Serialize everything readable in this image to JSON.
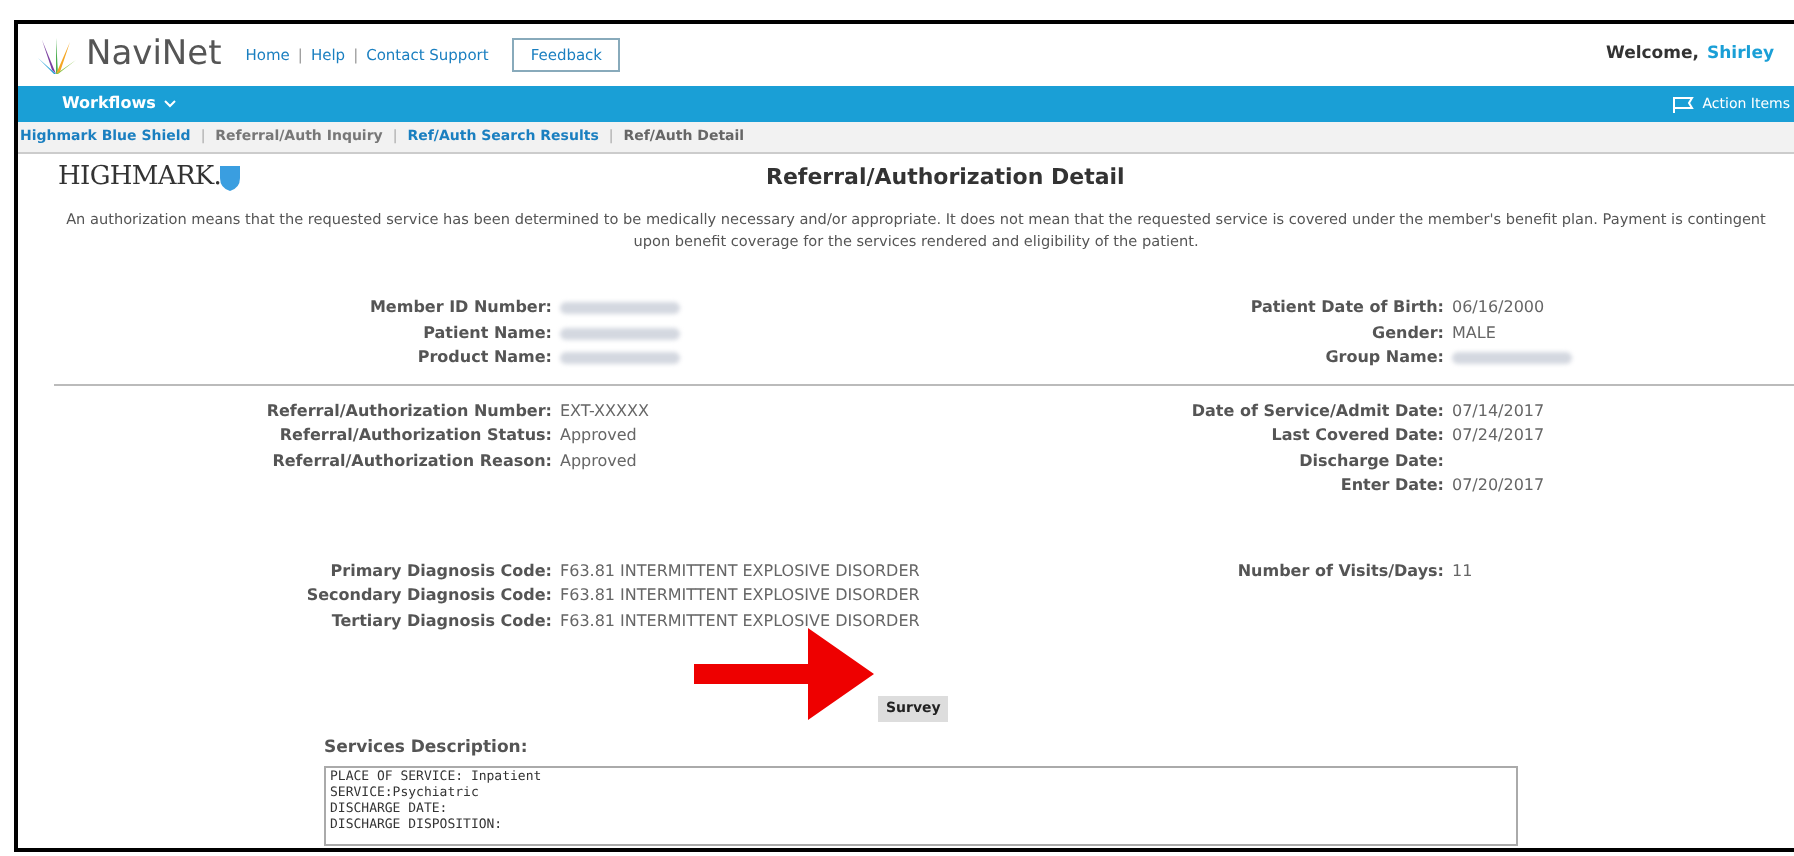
{
  "header": {
    "brand": "NaviNet",
    "links": [
      "Home",
      "Help",
      "Contact Support"
    ],
    "separator": "|",
    "feedback": "Feedback",
    "welcome": "Welcome,",
    "user": "Shirley"
  },
  "nav": {
    "menu": "Workflows",
    "action": "Action Items"
  },
  "breadcrumb_separator": "|",
  "breadcrumbs": [
    {
      "label": "Highmark Blue Shield",
      "selected": false
    },
    {
      "label": "Referral/Auth Inquiry",
      "selected": false
    },
    {
      "label": "Ref/Auth Search Results",
      "selected": false
    },
    {
      "label": "Ref/Auth Detail",
      "selected": true
    }
  ],
  "logo": "HIGHMARK.",
  "title": "Referral/Authorization Detail",
  "disclaimer": "An authorization means that the requested service has been determined to be medically necessary and/or appropriate. It does not mean that the requested service is covered under the member's benefit plan. Payment is contingent upon benefit coverage for the services rendered and eligibility of the patient.",
  "sections": [
    {
      "left": [
        {
          "label": "Member ID Number:",
          "redacted": true
        },
        {
          "label": "Patient Name:",
          "redacted": true
        },
        {
          "label": "Product Name:",
          "redacted": true
        }
      ],
      "right": [
        {
          "label": "Patient Date of Birth:",
          "value": "06/16/2000"
        },
        {
          "label": "Gender:",
          "value": "MALE"
        },
        {
          "label": "Group Name:",
          "redacted": true
        }
      ],
      "divider": true
    },
    {
      "left": [
        {
          "label": "Referral/Authorization Number:",
          "value": "EXT-XXXXX"
        },
        {
          "label": "Referral/Authorization Status:",
          "value": "Approved"
        },
        {
          "label": "Referral/Authorization Reason:",
          "value": "Approved"
        }
      ],
      "right": [
        {
          "label": "Date of Service/Admit Date:",
          "value": "07/14/2017"
        },
        {
          "label": "Last Covered Date:",
          "value": "07/24/2017"
        },
        {
          "label": "Discharge Date:"
        },
        {
          "label": "Enter Date:",
          "value": "07/20/2017"
        }
      ],
      "divider": false
    },
    {
      "left": [
        {
          "label": "Primary Diagnosis Code:",
          "value": "F63.81 INTERMITTENT EXPLOSIVE DISORDER"
        },
        {
          "label": "Secondary Diagnosis Code:",
          "value": "F63.81 INTERMITTENT EXPLOSIVE DISORDER"
        },
        {
          "label": "Tertiary Diagnosis Code:",
          "value": "F63.81 INTERMITTENT EXPLOSIVE DISORDER"
        }
      ],
      "right": [
        {
          "label": "Number of Visits/Days:",
          "value": "11"
        }
      ],
      "divider": false
    }
  ],
  "survey_button": "Survey",
  "services": {
    "label": "Services Description:",
    "lines": [
      "PLACE OF SERVICE: Inpatient",
      "SERVICE:Psychiatric",
      "DISCHARGE DATE:",
      "DISCHARGE DISPOSITION:"
    ]
  }
}
